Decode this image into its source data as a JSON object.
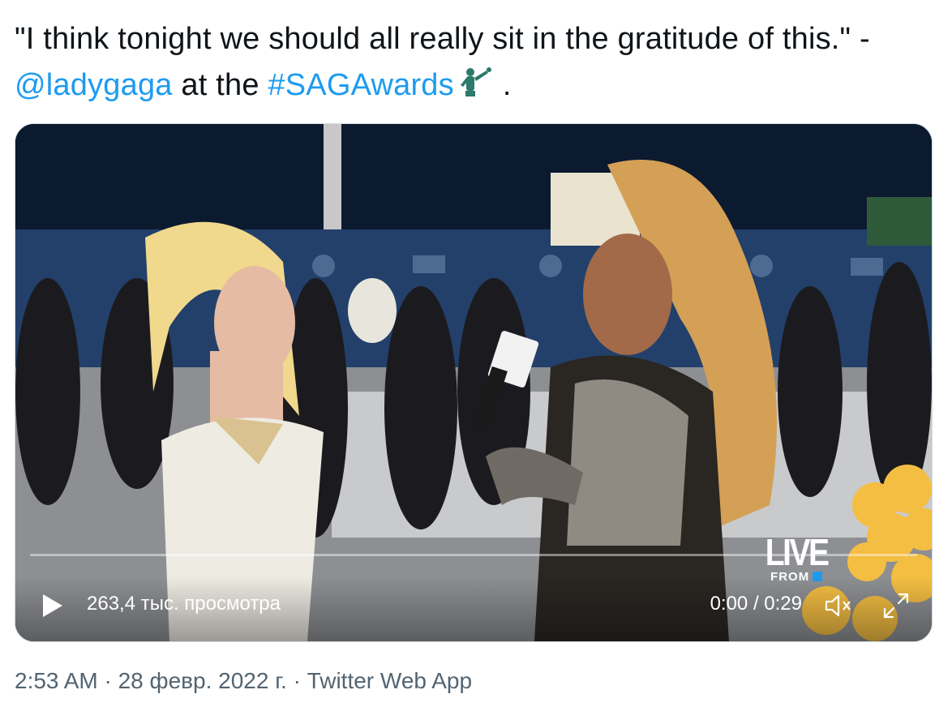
{
  "tweet": {
    "text_before": "\"I think tonight we should all really sit in the gratitude of this.\" - ",
    "mention": "@ladygaga",
    "text_middle": " at the ",
    "hashtag": "#SAGAwards",
    "text_after": ".",
    "emoji_icon": "sag-actor-statuette-icon"
  },
  "video": {
    "views": "263,4 тыс. просмотра",
    "time": "0:00 / 0:29",
    "progress": 0,
    "overlay_logo": {
      "line1": "LIVE",
      "line2": "FROM"
    },
    "icons": {
      "play": "play-icon",
      "volume": "volume-muted-icon",
      "fullscreen": "fullscreen-icon"
    }
  },
  "meta": {
    "line": "2:53 AM · 28 февр. 2022 г. · Twitter Web App"
  },
  "colors": {
    "link": "#1d9bf0",
    "text": "#0f1419",
    "secondary": "#536471",
    "border": "#cfd9de"
  }
}
